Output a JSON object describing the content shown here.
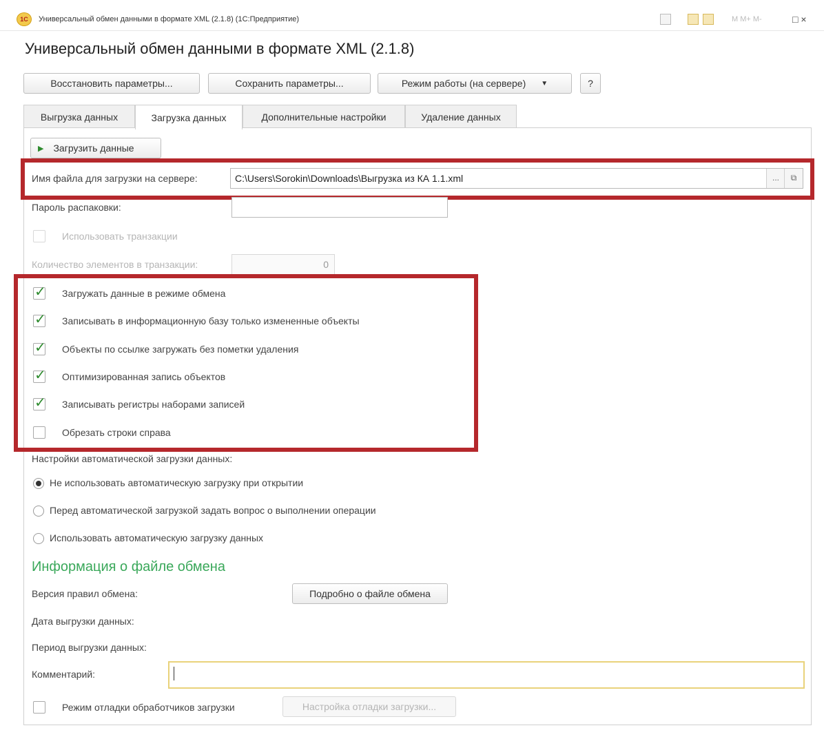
{
  "window": {
    "logo_text": "1С",
    "title": "Универсальный обмен данными в формате XML (2.1.8) (1С:Предприятие)",
    "toolbar_text": "M  M+  M-",
    "window_controls": "□ ×"
  },
  "app_title": "Универсальный обмен данными в формате XML (2.1.8)",
  "toolbar": {
    "restore_label": "Восстановить параметры...",
    "save_label": "Сохранить параметры...",
    "mode_label": "Режим работы (на сервере)",
    "mode_arrow": "▼",
    "help_label": "?"
  },
  "tabs": [
    {
      "label": "Выгрузка данных"
    },
    {
      "label": "Загрузка данных"
    },
    {
      "label": "Дополнительные настройки"
    },
    {
      "label": "Удаление данных"
    }
  ],
  "load_button": {
    "icon": "▶",
    "label": "Загрузить данные"
  },
  "file": {
    "label": "Имя файла для загрузки на сервере:",
    "value": "C:\\Users\\Sorokin\\Downloads\\Выгрузка из КА 1.1.xml",
    "browse": "...",
    "open": "⧉"
  },
  "password": {
    "label": "Пароль распаковки:",
    "value": ""
  },
  "use_transactions": {
    "label": "Использовать транзакции",
    "checked": false
  },
  "transaction_count": {
    "label": "Количество элементов в транзакции:",
    "value": "0"
  },
  "check": "✓",
  "options": [
    {
      "label": "Загружать данные в режиме обмена",
      "checked": true
    },
    {
      "label": "Записывать в информационную базу только измененные объекты",
      "checked": true
    },
    {
      "label": "Объекты по ссылке загружать без пометки удаления",
      "checked": true
    },
    {
      "label": "Оптимизированная запись объектов",
      "checked": true
    },
    {
      "label": "Записывать регистры наборами записей",
      "checked": true
    },
    {
      "label": "Обрезать строки справа",
      "checked": false
    }
  ],
  "auto_load": {
    "label": "Настройки автоматической загрузки данных:",
    "options": [
      {
        "label": "Не использовать автоматическую загрузку при открытии",
        "selected": true
      },
      {
        "label": "Перед автоматической загрузкой задать вопрос о выполнении операции",
        "selected": false
      },
      {
        "label": "Использовать автоматическую загрузку данных",
        "selected": false
      }
    ]
  },
  "info": {
    "title": "Информация о файле обмена",
    "rules_version_label": "Версия правил обмена:",
    "details_button": "Подробно о файле обмена",
    "export_date_label": "Дата выгрузки данных:",
    "export_period_label": "Период выгрузки данных:",
    "comment_label": "Комментарий:",
    "comment_value": ""
  },
  "debug": {
    "label": "Режим отладки обработчиков загрузки",
    "checked": false,
    "settings_button": "Настройка отладки загрузки..."
  }
}
